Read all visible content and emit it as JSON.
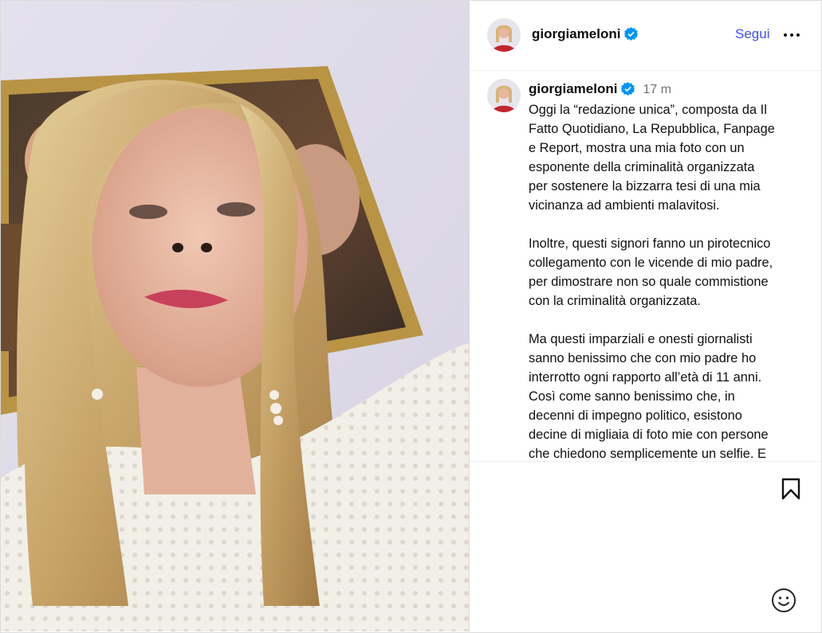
{
  "post": {
    "username": "giorgiameloni",
    "follow_label": "Segui",
    "more_icon": "more-horizontal-icon",
    "verified_icon": "verified-badge-icon",
    "caption_time": "17 m",
    "caption": {
      "p1": "Oggi la “redazione unica”, composta da Il\nFatto Quotidiano, La Repubblica, Fanpage\ne Report, mostra una mia foto con un\nesponente della criminalità organizzata\nper sostenere la bizzarra tesi di una mia\nvicinanza ad ambienti malavitosi.",
      "p2": "Inoltre, questi signori fanno un pirotecnico\ncollegamento con le vicende di mio padre,\nper dimostrare non so quale commistione\ncon la criminalità organizzata.",
      "p3": "Ma questi imparziali e onesti giornalisti\nsanno benissimo che con mio padre ho\ninterrotto ogni rapporto all’età di 11 anni.\nCosì come sanno benissimo che, in\ndecenni di impegno politico, esistono\ndecine di migliaia di foto mie con persone\nche chiedono semplicemente un selfie. E"
    },
    "bookmark_icon": "bookmark-icon",
    "emoji_icon": "emoji-smiley-icon"
  },
  "colors": {
    "follow": "#4150f7",
    "verified": "#0095f6",
    "border": "#dbdbdb",
    "muted": "#737373"
  }
}
